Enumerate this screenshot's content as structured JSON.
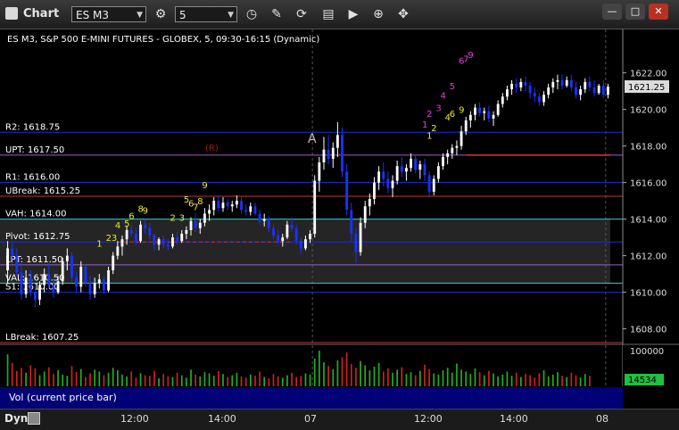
{
  "window": {
    "title": "Chart",
    "symbol": "ES M3",
    "interval": "5"
  },
  "chart_data": {
    "type": "candlestick",
    "title": "ES M3, S&P 500 E-MINI FUTURES - GLOBEX, 5, 09:30-16:15 (Dynamic)",
    "ylim": [
      1607.2,
      1623.3
    ],
    "y_ticks": [
      {
        "value": 1622,
        "label": "1622.00"
      },
      {
        "value": 1620,
        "label": "1620.00"
      },
      {
        "value": 1618,
        "label": "1618.00"
      },
      {
        "value": 1616,
        "label": "1616.00"
      },
      {
        "value": 1614,
        "label": "1614.00"
      },
      {
        "value": 1612,
        "label": "1612.00"
      },
      {
        "value": 1610,
        "label": "1610.00"
      },
      {
        "value": 1608,
        "label": "1608.00"
      }
    ],
    "x_ticks": [
      "12:00",
      "14:00",
      "07",
      "12:00",
      "14:00",
      "08"
    ],
    "last_price": {
      "value": 1621.25,
      "label": "1621.25"
    },
    "levels": [
      {
        "name": "R2",
        "label": "R2: 1618.75",
        "value": 1618.75,
        "color": "#1a2fd0"
      },
      {
        "name": "UPT",
        "label": "UPT: 1617.50",
        "value": 1617.5,
        "color": "#9a60c0"
      },
      {
        "name": "R1",
        "label": "R1: 1616.00",
        "value": 1616.0,
        "color": "#1a2fd0"
      },
      {
        "name": "UBreak",
        "label": "UBreak: 1615.25",
        "value": 1615.25,
        "color": "#c83030"
      },
      {
        "name": "VAH",
        "label": "VAH: 1614.00",
        "value": 1614.0,
        "color": "#30d0d0"
      },
      {
        "name": "Pivot",
        "label": "Pivot: 1612.75",
        "value": 1612.75,
        "color": "#1a2fd0"
      },
      {
        "name": "LPT",
        "label": "LPT: 1611.50",
        "value": 1611.5,
        "color": "#9a60c0"
      },
      {
        "name": "VAL",
        "label": "VAL: 1610.50",
        "value": 1610.5,
        "color": "#30d0d0"
      },
      {
        "name": "S1",
        "label": "S1: 1610.00",
        "value": 1610.0,
        "color": "#1a2fd0"
      },
      {
        "name": "LBreak",
        "label": "LBreak: 1607.25",
        "value": 1607.25,
        "color": "#c83030"
      }
    ],
    "value_area": [
      1610.5,
      1614.0
    ],
    "annotations": [
      "A",
      "(R)"
    ],
    "markers": [
      {
        "text": "1",
        "color": "#e8e830"
      },
      {
        "text": "23",
        "color": "#e8e830"
      },
      {
        "text": "4",
        "color": "#e8e830"
      },
      {
        "text": "5",
        "color": "#e8e830"
      },
      {
        "text": "6",
        "color": "#e8e830"
      },
      {
        "text": "8",
        "color": "#e8e830"
      },
      {
        "text": "9",
        "color": "#e8e830"
      },
      {
        "text": "2",
        "color": "#e8e830"
      },
      {
        "text": "3",
        "color": "#e8e830"
      },
      {
        "text": "5",
        "color": "#e8e830"
      },
      {
        "text": "6",
        "color": "#e8e830"
      },
      {
        "text": "7",
        "color": "#e8e830"
      },
      {
        "text": "8",
        "color": "#e8e830"
      },
      {
        "text": "9",
        "color": "#e8e830"
      },
      {
        "text": "1",
        "color": "#e8e830"
      },
      {
        "text": "2",
        "color": "#e8e830"
      },
      {
        "text": "4",
        "color": "#e8e830"
      },
      {
        "text": "6",
        "color": "#e8e830"
      },
      {
        "text": "9",
        "color": "#e8e830"
      },
      {
        "text": "1",
        "color": "#e040e0"
      },
      {
        "text": "2",
        "color": "#e040e0"
      },
      {
        "text": "3",
        "color": "#e040e0"
      },
      {
        "text": "4",
        "color": "#e040e0"
      },
      {
        "text": "5",
        "color": "#e040e0"
      },
      {
        "text": "6",
        "color": "#e040e0"
      },
      {
        "text": "7",
        "color": "#e040e0"
      },
      {
        "text": "9",
        "color": "#e040e0"
      }
    ],
    "candles": [
      [
        1611.2,
        1612.8,
        1610.5,
        1612.4
      ],
      [
        1612.4,
        1612.7,
        1611.8,
        1612.0
      ],
      [
        1612.0,
        1612.4,
        1610.9,
        1611.1
      ],
      [
        1611.1,
        1611.6,
        1609.6,
        1609.9
      ],
      [
        1609.9,
        1611.2,
        1609.7,
        1610.8
      ],
      [
        1610.8,
        1611.2,
        1609.8,
        1610.0
      ],
      [
        1610.0,
        1610.4,
        1609.2,
        1609.6
      ],
      [
        1609.6,
        1610.6,
        1609.3,
        1610.4
      ],
      [
        1610.4,
        1611.3,
        1610.0,
        1611.0
      ],
      [
        1611.0,
        1611.6,
        1610.2,
        1610.4
      ],
      [
        1610.4,
        1610.8,
        1609.7,
        1610.0
      ],
      [
        1610.0,
        1610.9,
        1609.9,
        1610.6
      ],
      [
        1610.6,
        1611.9,
        1610.4,
        1611.7
      ],
      [
        1611.7,
        1612.4,
        1611.2,
        1612.0
      ],
      [
        1612.0,
        1612.2,
        1610.6,
        1610.8
      ],
      [
        1610.8,
        1611.1,
        1610.0,
        1610.3
      ],
      [
        1610.3,
        1611.7,
        1610.0,
        1611.4
      ],
      [
        1611.4,
        1611.5,
        1610.3,
        1610.5
      ],
      [
        1610.5,
        1610.9,
        1609.6,
        1609.9
      ],
      [
        1609.9,
        1610.8,
        1609.7,
        1610.5
      ],
      [
        1610.5,
        1611.0,
        1610.2,
        1610.7
      ],
      [
        1610.7,
        1610.9,
        1609.9,
        1610.1
      ],
      [
        1610.1,
        1611.4,
        1610.0,
        1611.2
      ],
      [
        1611.2,
        1612.2,
        1611.0,
        1612.0
      ],
      [
        1612.0,
        1612.8,
        1611.8,
        1612.5
      ],
      [
        1612.5,
        1613.1,
        1612.0,
        1612.9
      ],
      [
        1612.9,
        1613.6,
        1612.6,
        1613.4
      ],
      [
        1613.4,
        1613.7,
        1613.0,
        1613.2
      ],
      [
        1613.2,
        1613.5,
        1612.6,
        1612.8
      ],
      [
        1612.8,
        1613.9,
        1612.7,
        1613.7
      ],
      [
        1613.7,
        1614.0,
        1613.2,
        1613.5
      ],
      [
        1613.5,
        1613.8,
        1612.9,
        1613.1
      ],
      [
        1613.1,
        1613.2,
        1612.3,
        1612.6
      ],
      [
        1612.6,
        1613.0,
        1612.3,
        1612.9
      ],
      [
        1612.9,
        1613.1,
        1612.4,
        1612.6
      ],
      [
        1612.6,
        1612.9,
        1612.3,
        1612.5
      ],
      [
        1612.5,
        1613.2,
        1612.4,
        1613.0
      ],
      [
        1613.0,
        1613.3,
        1612.6,
        1612.8
      ],
      [
        1612.8,
        1613.4,
        1612.7,
        1613.2
      ],
      [
        1613.2,
        1613.6,
        1612.9,
        1613.4
      ],
      [
        1613.4,
        1614.1,
        1613.1,
        1613.9
      ],
      [
        1613.9,
        1614.3,
        1613.3,
        1613.5
      ],
      [
        1613.5,
        1614.0,
        1613.2,
        1613.8
      ],
      [
        1613.8,
        1614.6,
        1613.6,
        1614.3
      ],
      [
        1614.3,
        1614.8,
        1613.9,
        1614.5
      ],
      [
        1614.5,
        1615.2,
        1614.2,
        1615.0
      ],
      [
        1615.0,
        1615.3,
        1614.4,
        1614.6
      ],
      [
        1614.6,
        1615.2,
        1614.4,
        1614.9
      ],
      [
        1614.9,
        1615.1,
        1614.5,
        1614.7
      ],
      [
        1614.7,
        1615.0,
        1614.4,
        1614.8
      ],
      [
        1614.8,
        1615.3,
        1614.6,
        1615.0
      ],
      [
        1615.0,
        1615.2,
        1614.3,
        1614.5
      ],
      [
        1614.5,
        1614.8,
        1614.2,
        1614.4
      ],
      [
        1614.4,
        1614.9,
        1614.2,
        1614.7
      ],
      [
        1614.7,
        1614.9,
        1614.2,
        1614.3
      ],
      [
        1614.3,
        1614.5,
        1613.7,
        1613.9
      ],
      [
        1613.9,
        1614.3,
        1613.6,
        1614.0
      ],
      [
        1614.0,
        1614.2,
        1613.3,
        1613.5
      ],
      [
        1613.5,
        1613.7,
        1612.9,
        1613.1
      ],
      [
        1613.1,
        1613.4,
        1612.6,
        1612.8
      ],
      [
        1612.8,
        1613.2,
        1612.5,
        1613.0
      ],
      [
        1613.0,
        1613.9,
        1612.9,
        1613.7
      ],
      [
        1613.7,
        1614.1,
        1613.3,
        1613.5
      ],
      [
        1613.5,
        1613.7,
        1612.6,
        1612.8
      ],
      [
        1612.8,
        1613.0,
        1612.1,
        1612.4
      ],
      [
        1612.4,
        1613.1,
        1612.3,
        1612.9
      ],
      [
        1612.9,
        1613.4,
        1612.7,
        1613.2
      ],
      [
        1613.2,
        1616.4,
        1613.0,
        1616.1
      ],
      [
        1616.1,
        1617.4,
        1615.5,
        1617.1
      ],
      [
        1617.1,
        1618.5,
        1616.7,
        1617.8
      ],
      [
        1617.8,
        1618.6,
        1617.0,
        1617.3
      ],
      [
        1617.3,
        1618.2,
        1616.8,
        1617.9
      ],
      [
        1617.9,
        1619.3,
        1617.4,
        1618.6
      ],
      [
        1618.6,
        1619.0,
        1616.3,
        1616.6
      ],
      [
        1616.6,
        1617.0,
        1614.2,
        1614.5
      ],
      [
        1614.5,
        1614.9,
        1612.8,
        1613.2
      ],
      [
        1613.2,
        1613.5,
        1611.6,
        1612.2
      ],
      [
        1612.2,
        1614.1,
        1612.0,
        1613.8
      ],
      [
        1613.8,
        1615.0,
        1613.5,
        1614.7
      ],
      [
        1614.7,
        1615.4,
        1614.2,
        1615.1
      ],
      [
        1615.1,
        1616.3,
        1614.8,
        1616.0
      ],
      [
        1616.0,
        1616.9,
        1615.6,
        1616.6
      ],
      [
        1616.6,
        1617.1,
        1615.8,
        1616.2
      ],
      [
        1616.2,
        1616.6,
        1615.4,
        1615.7
      ],
      [
        1615.7,
        1616.4,
        1615.2,
        1616.1
      ],
      [
        1616.1,
        1617.2,
        1615.9,
        1616.9
      ],
      [
        1616.9,
        1617.4,
        1616.3,
        1616.6
      ],
      [
        1616.6,
        1617.0,
        1616.1,
        1616.8
      ],
      [
        1616.8,
        1617.6,
        1616.6,
        1617.3
      ],
      [
        1617.3,
        1617.5,
        1616.5,
        1616.7
      ],
      [
        1616.7,
        1617.2,
        1616.2,
        1617.0
      ],
      [
        1617.0,
        1617.3,
        1616.1,
        1616.4
      ],
      [
        1616.4,
        1616.6,
        1615.2,
        1615.5
      ],
      [
        1615.5,
        1616.4,
        1615.3,
        1616.2
      ],
      [
        1616.2,
        1617.1,
        1616.0,
        1616.9
      ],
      [
        1616.9,
        1617.6,
        1616.7,
        1617.4
      ],
      [
        1617.4,
        1617.8,
        1617.0,
        1617.6
      ],
      [
        1617.6,
        1618.1,
        1617.3,
        1617.9
      ],
      [
        1617.9,
        1618.3,
        1617.5,
        1618.0
      ],
      [
        1618.0,
        1619.1,
        1617.8,
        1618.8
      ],
      [
        1618.8,
        1619.6,
        1618.6,
        1619.4
      ],
      [
        1619.4,
        1619.9,
        1619.0,
        1619.7
      ],
      [
        1619.7,
        1620.3,
        1619.4,
        1620.1
      ],
      [
        1620.1,
        1620.4,
        1619.6,
        1619.8
      ],
      [
        1619.8,
        1620.1,
        1619.4,
        1619.9
      ],
      [
        1619.9,
        1620.2,
        1619.3,
        1619.5
      ],
      [
        1619.5,
        1619.9,
        1619.1,
        1619.7
      ],
      [
        1619.7,
        1620.5,
        1619.6,
        1620.3
      ],
      [
        1620.3,
        1620.9,
        1620.1,
        1620.7
      ],
      [
        1620.7,
        1621.3,
        1620.5,
        1621.1
      ],
      [
        1621.1,
        1621.6,
        1620.8,
        1621.4
      ],
      [
        1621.4,
        1621.7,
        1620.9,
        1621.2
      ],
      [
        1621.2,
        1621.7,
        1621.0,
        1621.5
      ],
      [
        1621.5,
        1621.8,
        1621.0,
        1621.3
      ],
      [
        1621.3,
        1621.5,
        1620.6,
        1620.9
      ],
      [
        1620.9,
        1621.2,
        1620.4,
        1620.7
      ],
      [
        1620.7,
        1620.9,
        1620.2,
        1620.4
      ],
      [
        1620.4,
        1621.0,
        1620.2,
        1620.8
      ],
      [
        1620.8,
        1621.4,
        1620.6,
        1621.2
      ],
      [
        1621.2,
        1621.7,
        1620.9,
        1621.5
      ],
      [
        1621.5,
        1621.9,
        1621.1,
        1621.6
      ],
      [
        1621.6,
        1621.9,
        1621.1,
        1621.3
      ],
      [
        1621.3,
        1621.8,
        1621.2,
        1621.6
      ],
      [
        1621.6,
        1621.9,
        1621.0,
        1621.2
      ],
      [
        1621.2,
        1621.5,
        1620.6,
        1620.8
      ],
      [
        1620.8,
        1621.3,
        1620.5,
        1621.1
      ],
      [
        1621.1,
        1621.7,
        1620.9,
        1621.5
      ],
      [
        1621.5,
        1621.8,
        1621.0,
        1621.2
      ],
      [
        1621.2,
        1621.6,
        1620.7,
        1620.9
      ],
      [
        1620.9,
        1621.4,
        1620.8,
        1621.3
      ],
      [
        1621.3,
        1621.6,
        1620.6,
        1620.8
      ],
      [
        1620.8,
        1621.4,
        1620.6,
        1621.25
      ]
    ]
  },
  "volume_panel": {
    "label": "Vol (current price bar)",
    "y_ticks": [
      {
        "value": 100000,
        "label": "100000"
      }
    ],
    "last_value": 14534,
    "last_label": "14534",
    "values": [
      52,
      38,
      25,
      30,
      22,
      34,
      29,
      18,
      24,
      31,
      20,
      26,
      19,
      17,
      33,
      23,
      28,
      15,
      21,
      27,
      24,
      18,
      22,
      30,
      26,
      19,
      16,
      24,
      14,
      21,
      18,
      17,
      25,
      13,
      20,
      16,
      15,
      22,
      18,
      14,
      27,
      19,
      16,
      23,
      21,
      17,
      25,
      20,
      15,
      18,
      22,
      16,
      14,
      19,
      17,
      24,
      15,
      13,
      20,
      16,
      14,
      18,
      22,
      15,
      17,
      21,
      19,
      45,
      58,
      39,
      33,
      28,
      42,
      47,
      55,
      36,
      30,
      41,
      34,
      26,
      32,
      38,
      24,
      29,
      22,
      27,
      31,
      20,
      23,
      18,
      25,
      35,
      28,
      21,
      19,
      26,
      30,
      22,
      37,
      27,
      24,
      20,
      29,
      23,
      18,
      25,
      21,
      16,
      19,
      24,
      17,
      22,
      15,
      20,
      18,
      14,
      21,
      26,
      16,
      19,
      23,
      17,
      15,
      22,
      18,
      14,
      20,
      17
    ]
  },
  "bottombar": {
    "label": "Dyn"
  }
}
